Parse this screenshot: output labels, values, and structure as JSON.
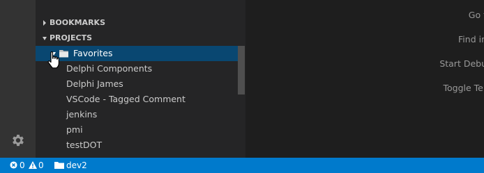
{
  "sidebar": {
    "bookmarks_header": "BOOKMARKS",
    "projects_header": "PROJECTS",
    "projects": [
      {
        "label": "Favorites",
        "selected": true,
        "type": "folder"
      },
      {
        "label": "Delphi Components"
      },
      {
        "label": "Delphi James"
      },
      {
        "label": "VSCode - Tagged Comment"
      },
      {
        "label": "jenkins"
      },
      {
        "label": "pmi"
      },
      {
        "label": "testDOT"
      }
    ]
  },
  "editor": {
    "hints": [
      "Go t",
      "Find in",
      "Start Debu",
      "Toggle Ter"
    ]
  },
  "status_bar": {
    "errors": "0",
    "warnings": "0",
    "folder": "dev2"
  },
  "colors": {
    "accent": "#007acc",
    "selection": "#094771"
  }
}
